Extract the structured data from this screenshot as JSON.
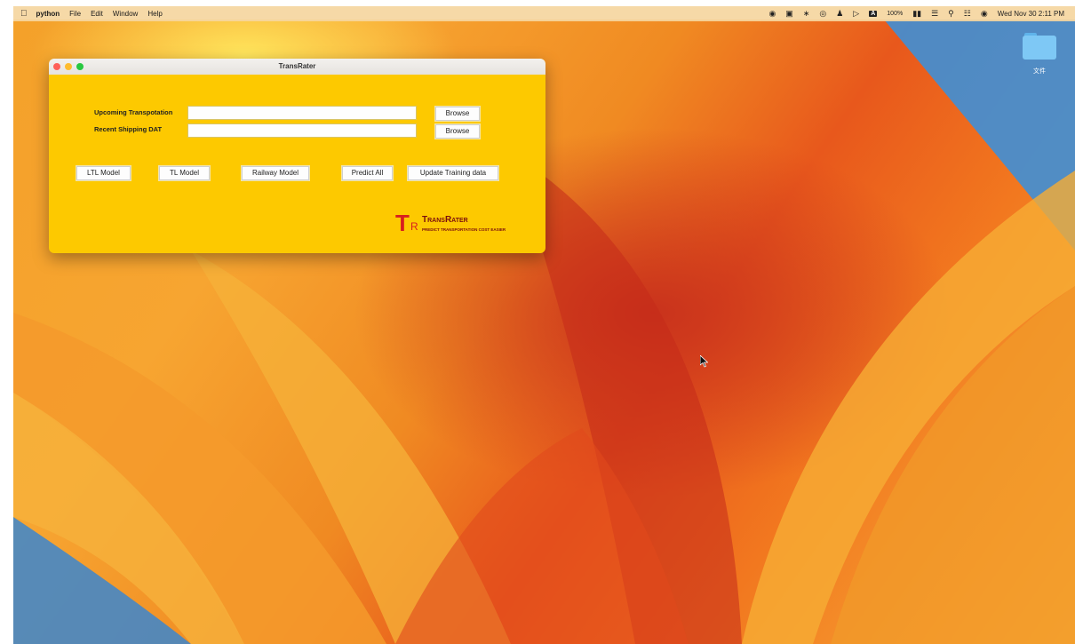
{
  "menubar": {
    "apple_icon": "apple-logo-icon",
    "app_name": "python",
    "menus": [
      "File",
      "Edit",
      "Window",
      "Help"
    ],
    "status": {
      "battery_percent": "100%",
      "input_source": "A",
      "datetime": "Wed Nov 30  2:11 PM"
    }
  },
  "desktop": {
    "folder_label": "文件"
  },
  "window": {
    "title": "TransRater",
    "fields": [
      {
        "label": "Upcoming Transpotation",
        "value": "",
        "browse_label": "Browse"
      },
      {
        "label": "Recent Shipping DAT",
        "value": "",
        "browse_label": "Browse"
      }
    ],
    "buttons": [
      "LTL Model",
      "TL Model",
      "Railway Model",
      "Predict All",
      "Update Training data"
    ],
    "logo": {
      "letter_t": "T",
      "letter_r": "R",
      "brand": "TransRater",
      "tagline": "PREDICT TRANSPORTATION COST EASIER"
    }
  },
  "colors": {
    "window_bg": "#fdc900",
    "logo_red": "#d81e1e"
  }
}
